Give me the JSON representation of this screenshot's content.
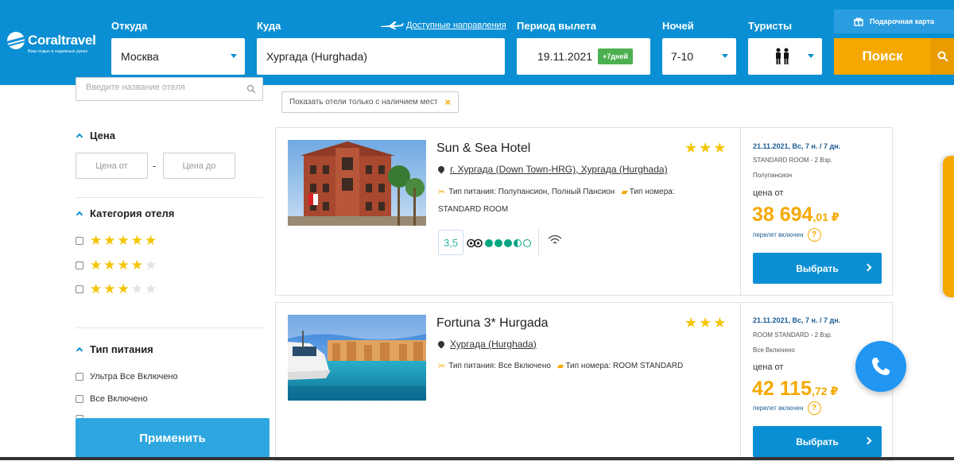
{
  "header": {
    "logo_name": "Coraltravel",
    "logo_tagline": "Ваш отдых в надежных руках",
    "from_label": "Откуда",
    "from_value": "Москва",
    "to_label": "Куда",
    "to_value": "Хургада (Hurghada)",
    "directions_link": "Доступные направления",
    "period_label": "Период вылета",
    "period_value": "19.11.2021",
    "period_badge": "+7дней",
    "nights_label": "Ночей",
    "nights_value": "7-10",
    "tourists_label": "Туристы",
    "gift_card": "Подарочная карта",
    "search_button": "Поиск",
    "accent_color": "#0a8fd4",
    "search_color": "#f5a800"
  },
  "sidebar": {
    "hotel_placeholder": "Введите название отеля",
    "price_title": "Цена",
    "price_from_placeholder": "Цена от",
    "price_to_placeholder": "Цена до",
    "price_dash": "-",
    "category_title": "Категория отеля",
    "category_options": [
      5,
      4,
      3
    ],
    "food_title": "Тип питания",
    "food_options": [
      "Ультра Все Включено",
      "Все Включено"
    ],
    "apply_button": "Применить"
  },
  "filter_chip": "Показать отели только с наличием мест",
  "hotels": [
    {
      "name": "Sun & Sea Hotel",
      "stars": 3,
      "location": "г. Хургада (Down Town-HRG), Хургада (Hurghada)",
      "meal": "Тип питания: Полупансион, Полный Пансион",
      "room_label": "Тип номера:",
      "room_type": "STANDARD ROOM",
      "rating": "3,5",
      "tripadvisor_bubbles": 3.5,
      "date_line": "21.11.2021, Вс, 7 н. / 7 дн.",
      "room_line": "STANDARD ROOM - 2 Взр.",
      "board_line": "Полупансион",
      "price_from": "цена от",
      "price_main": "38 694",
      "price_cents": ",01 ₽",
      "flight_included": "перелет включен",
      "choose_button": "Выбрать"
    },
    {
      "name": "Fortuna 3* Hurgada",
      "stars": 3,
      "location": "Хургада (Hurghada)",
      "meal": "Тип питания: Все Включено",
      "room_label": "Тип номера: ROOM STANDARD",
      "date_line": "21.11.2021, Вс, 7 н. / 7 дн.",
      "room_line": "ROOM STANDARD - 2 Взр.",
      "board_line": "Все Включено",
      "price_from": "цена от",
      "price_main": "42 115",
      "price_cents": ",72 ₽",
      "flight_included": "перелет включен",
      "choose_button": "Выбрать"
    }
  ],
  "icons": {
    "help": "?",
    "chip_close": "×"
  }
}
